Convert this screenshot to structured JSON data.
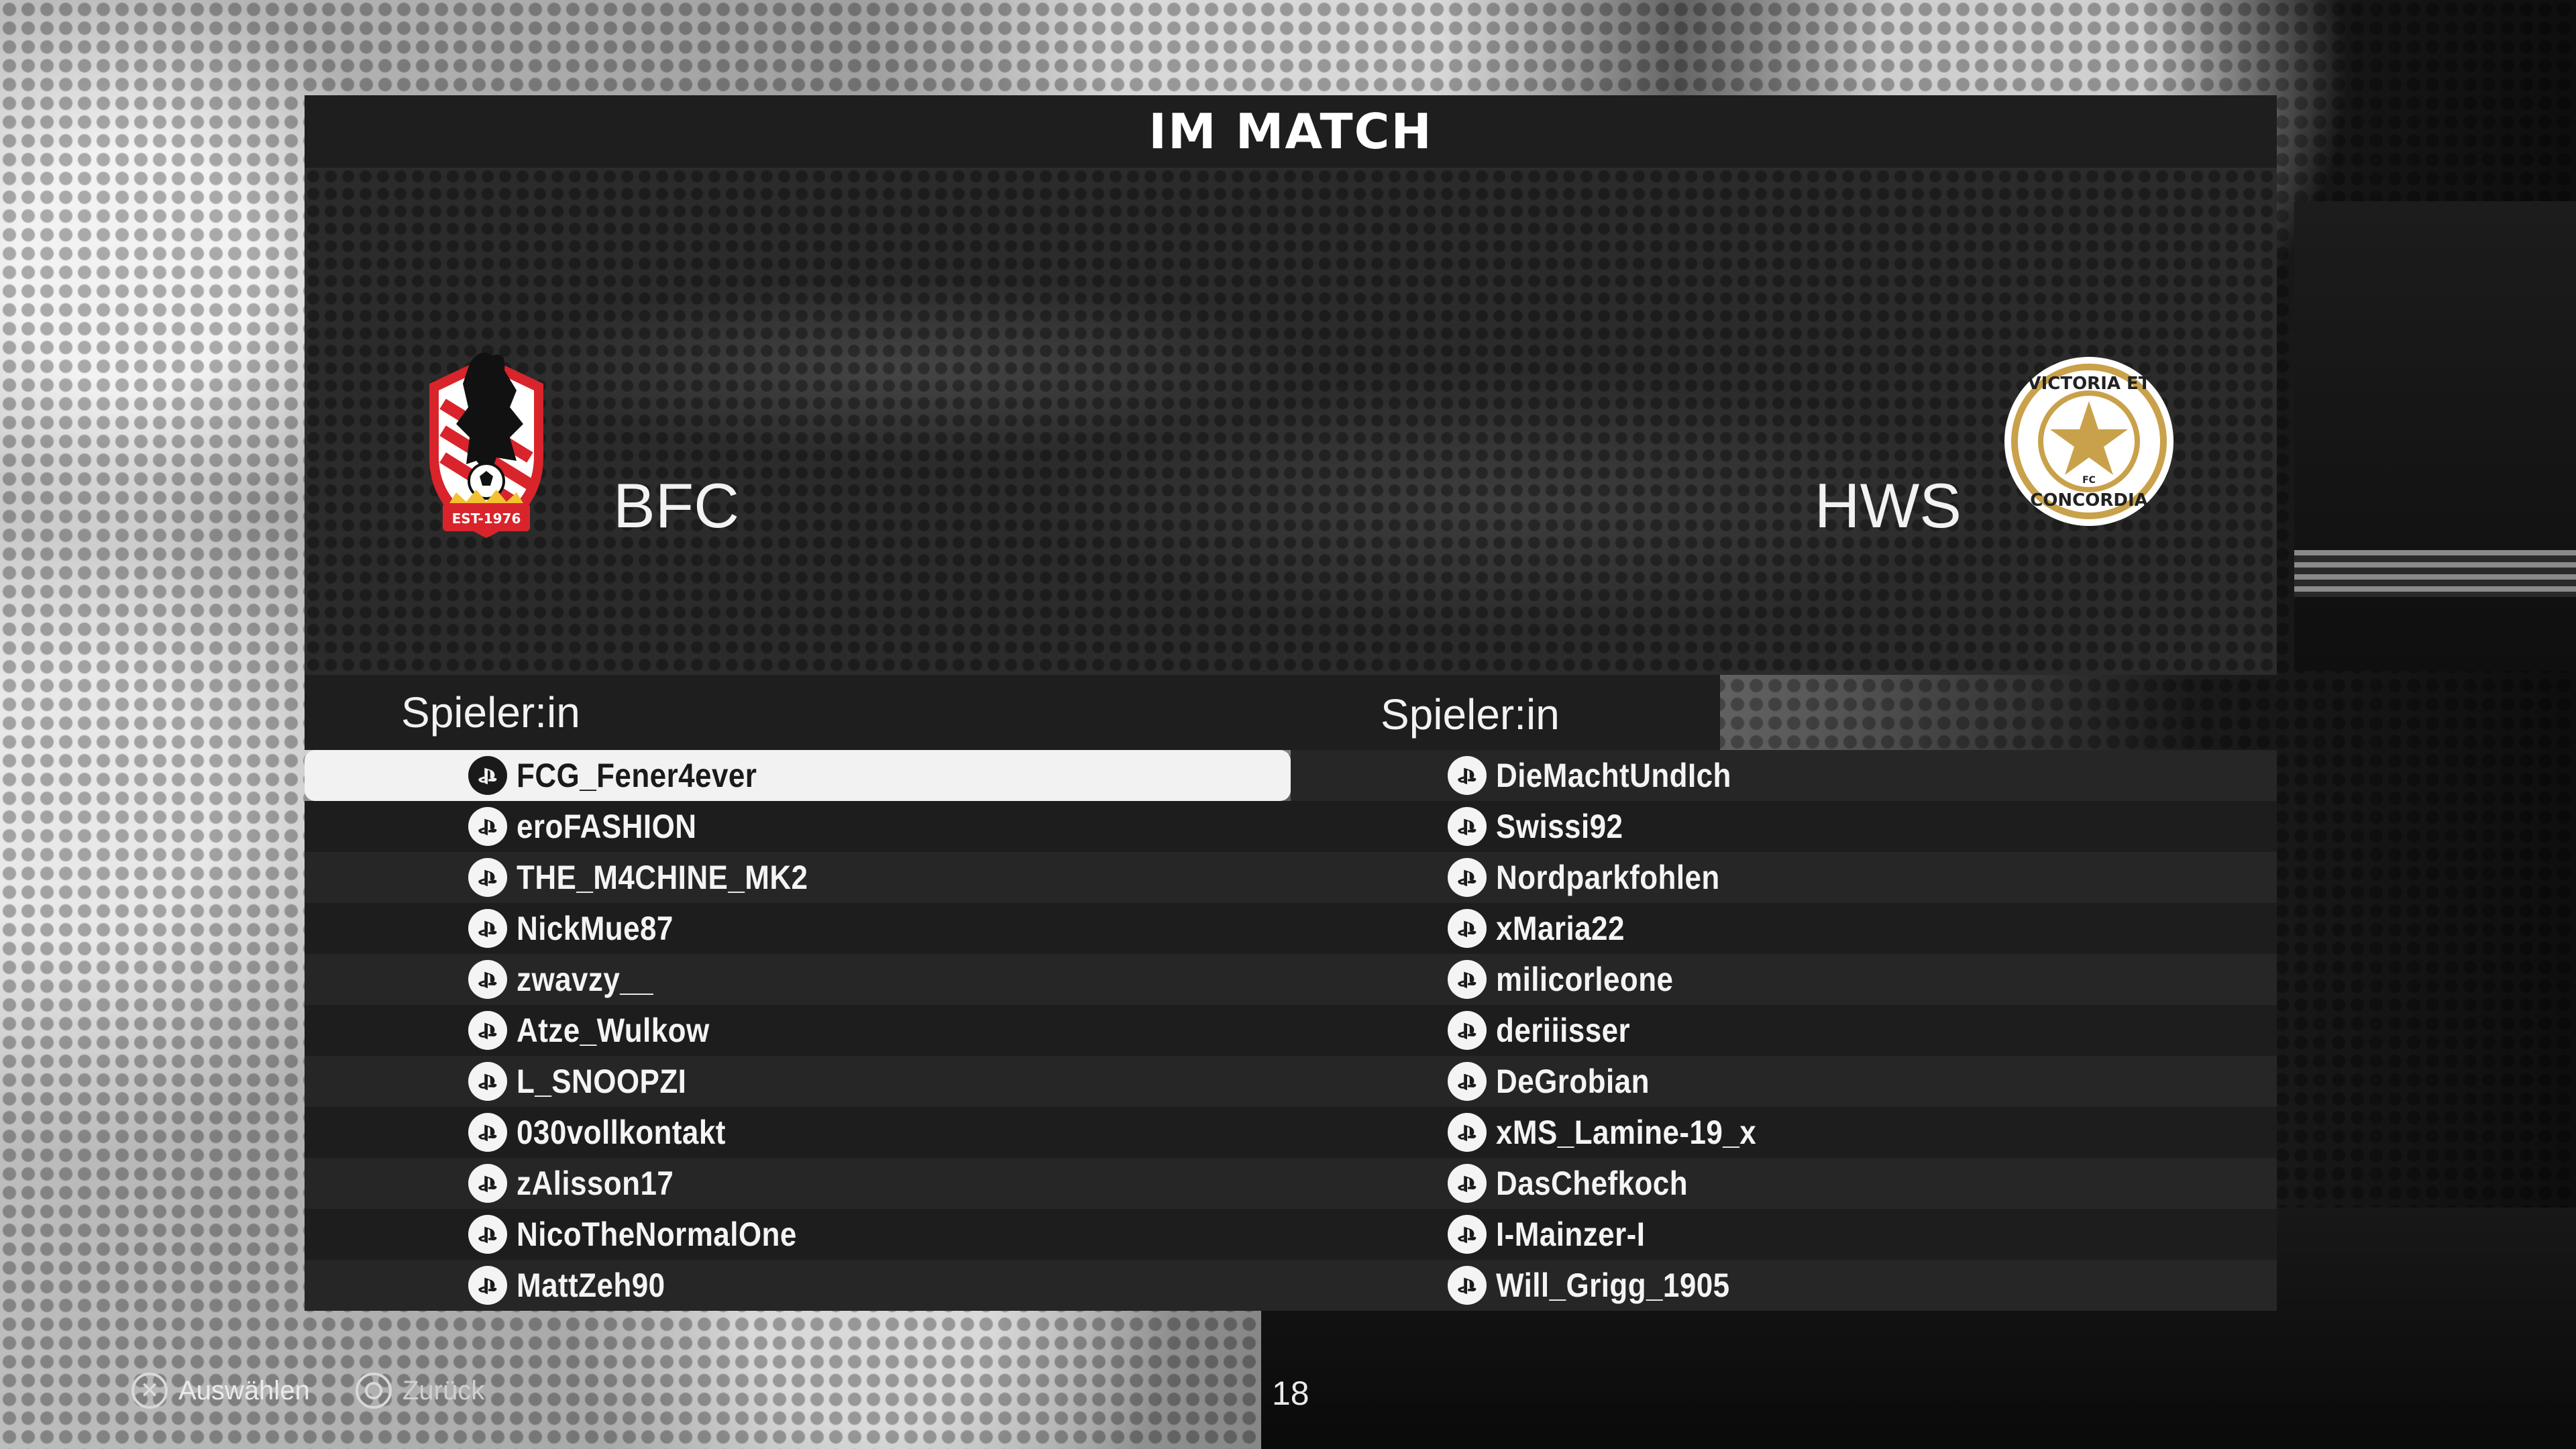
{
  "screen": {
    "title": "IM MATCH"
  },
  "teams": {
    "home": {
      "name": "BFC",
      "crest": "bear-crest-icon",
      "crest_text": "EST-1976"
    },
    "away": {
      "name": "HWS",
      "crest": "star-crest-icon",
      "crest_text_top": "VICTORIA ET",
      "crest_text_bottom": "CONCORDIA",
      "crest_text_center": "FC"
    }
  },
  "rosters": {
    "home": {
      "header": "Spieler:in",
      "players": [
        {
          "name": "FCG_Fener4ever",
          "selected": true
        },
        {
          "name": "eroFASHION"
        },
        {
          "name": "THE_M4CHINE_MK2"
        },
        {
          "name": "NickMue87"
        },
        {
          "name": "zwavzy__"
        },
        {
          "name": "Atze_Wulkow"
        },
        {
          "name": "L_SNOOPZI"
        },
        {
          "name": "030vollkontakt"
        },
        {
          "name": "zAlisson17"
        },
        {
          "name": "NicoTheNormalOne"
        },
        {
          "name": "MattZeh90"
        }
      ]
    },
    "away": {
      "header": "Spieler:in",
      "players": [
        {
          "name": "DieMachtUndIch"
        },
        {
          "name": "Swissi92"
        },
        {
          "name": "Nordparkfohlen"
        },
        {
          "name": "xMaria22"
        },
        {
          "name": "milicorleone"
        },
        {
          "name": "deriiisser"
        },
        {
          "name": "DeGrobian"
        },
        {
          "name": "xMS_Lamine-19_x"
        },
        {
          "name": "DasChefkoch"
        },
        {
          "name": "I-Mainzer-I"
        },
        {
          "name": "Will_Grigg_1905"
        }
      ]
    }
  },
  "platform_icon": "playstation-icon",
  "footer": {
    "select_label": "Auswählen",
    "back_label": "Zurück",
    "page_number": "18"
  },
  "colors": {
    "panel_dark": "#1e1e1e",
    "row_alt": "#262626",
    "selected_row": "#f2f2f2",
    "bfc_red": "#d9242b",
    "hws_gold": "#c9a14a"
  }
}
